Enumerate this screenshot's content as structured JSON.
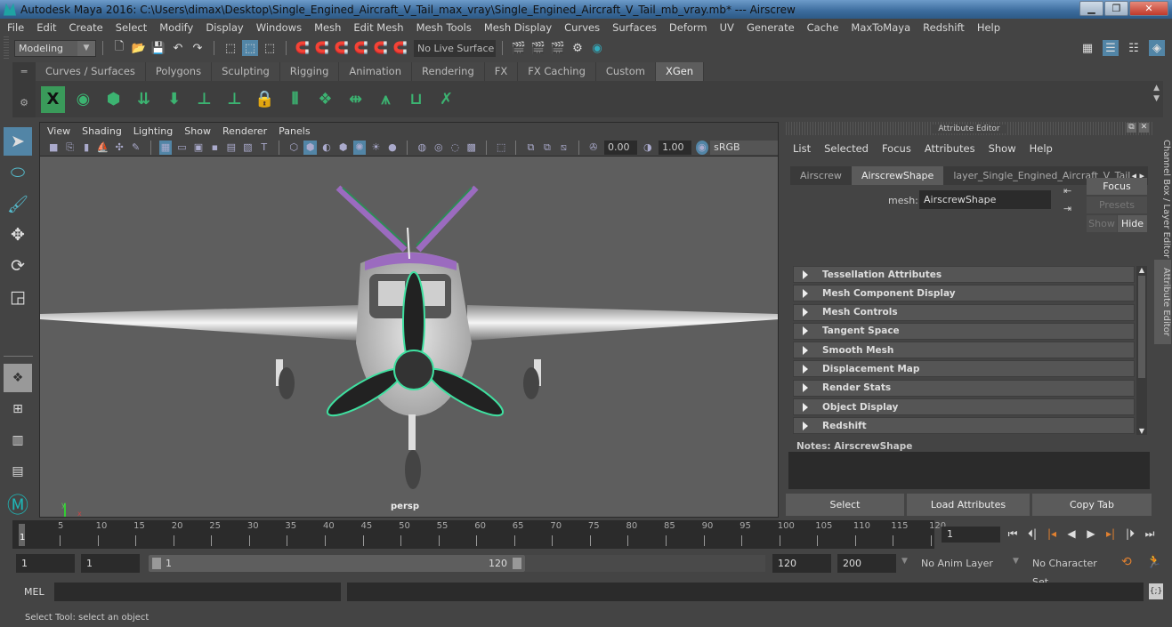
{
  "window": {
    "title": "Autodesk Maya 2016: C:\\Users\\dimax\\Desktop\\Single_Engined_Aircraft_V_Tail_max_vray\\Single_Engined_Aircraft_V_Tail_mb_vray.mb*   ---   Airscrew",
    "controls": [
      "minimize",
      "restore",
      "close"
    ]
  },
  "menubar": [
    "File",
    "Edit",
    "Create",
    "Select",
    "Modify",
    "Display",
    "Windows",
    "Mesh",
    "Edit Mesh",
    "Mesh Tools",
    "Mesh Display",
    "Curves",
    "Surfaces",
    "Deform",
    "UV",
    "Generate",
    "Cache",
    "MaxToMaya",
    "Redshift",
    "Help"
  ],
  "statusline": {
    "mode": "Modeling",
    "live_surface": "No Live Surface"
  },
  "shelf": {
    "tabs": [
      "Curves / Surfaces",
      "Polygons",
      "Sculpting",
      "Rigging",
      "Animation",
      "Rendering",
      "FX",
      "FX Caching",
      "Custom",
      "XGen"
    ],
    "active_tab": "XGen",
    "icons": [
      "xgen-editor-icon",
      "xgen-preview-icon",
      "xgen-clear-preview-icon",
      "add-guides-icon",
      "place-guides-icon",
      "add-guide-icon",
      "sculpt-guide-icon",
      "lock-guide-icon",
      "rebuild-guides-icon",
      "convert-guides-icon",
      "mirror-guides-icon",
      "select-guides-icon",
      "guide-outline-icon",
      "delete-guides-icon"
    ]
  },
  "toolbox": [
    "select-tool-icon",
    "lasso-tool-icon",
    "paint-select-tool-icon",
    "move-tool-icon",
    "rotate-tool-icon",
    "scale-tool-icon"
  ],
  "viewport": {
    "menu": [
      "View",
      "Shading",
      "Lighting",
      "Show",
      "Renderer",
      "Panels"
    ],
    "exposure": "0.00",
    "gamma": "1.00",
    "color_space": "sRGB gamma",
    "camera_label": "persp",
    "axis": {
      "y": "y",
      "x": "x"
    }
  },
  "attribute_editor": {
    "title": "Attribute Editor",
    "menu": [
      "List",
      "Selected",
      "Focus",
      "Attributes",
      "Show",
      "Help"
    ],
    "tabs": [
      "Airscrew",
      "AirscrewShape",
      "layer_Single_Engined_Aircraft_V_Tail"
    ],
    "active_tab": "AirscrewShape",
    "mesh_label": "mesh:",
    "mesh_value": "AirscrewShape",
    "focus_btn": "Focus",
    "presets_btn": "Presets",
    "show_btn": "Show",
    "hide_btn": "Hide",
    "sections": [
      "Tessellation Attributes",
      "Mesh Component Display",
      "Mesh Controls",
      "Tangent Space",
      "Smooth Mesh",
      "Displacement Map",
      "Render Stats",
      "Object Display",
      "Redshift"
    ],
    "notes_label": "Notes:  AirscrewShape",
    "buttons": [
      "Select",
      "Load Attributes",
      "Copy Tab"
    ]
  },
  "side_tabs": [
    "Channel Box / Layer Editor",
    "Attribute Editor"
  ],
  "timeline": {
    "ticks": [
      5,
      10,
      15,
      20,
      25,
      30,
      35,
      40,
      45,
      50,
      55,
      60,
      65,
      70,
      75,
      80,
      85,
      90,
      95,
      100,
      105,
      110,
      115,
      120
    ],
    "start_label": "1",
    "current_frame": "1",
    "range_start": 1,
    "range_end": 120
  },
  "range": {
    "start": "1",
    "anim_start": "1",
    "slider_start": "1",
    "slider_end": "120",
    "end": "120",
    "anim_end": "200",
    "anim_layer": "No Anim Layer",
    "character_set": "No Character Set"
  },
  "cmdline": {
    "label": "MEL"
  },
  "status": "Select Tool: select an object"
}
